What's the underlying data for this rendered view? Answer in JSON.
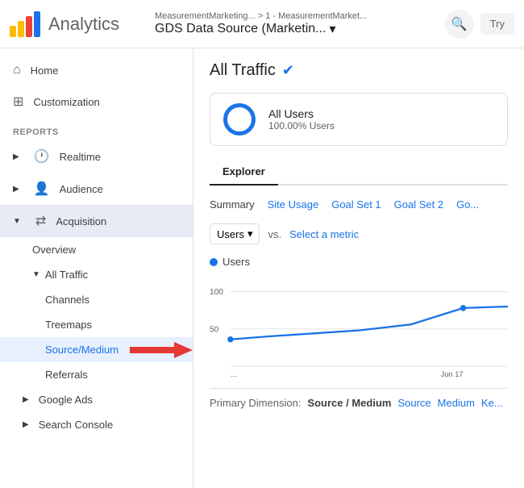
{
  "header": {
    "logo_title": "Analytics",
    "breadcrumb": "MeasurementMarketing... > 1 - MeasurementMarket...",
    "datasource": "GDS Data Source (Marketin...",
    "search_label": "🔍",
    "try_label": "Try"
  },
  "sidebar": {
    "items": [
      {
        "id": "home",
        "label": "Home",
        "icon": "⌂",
        "level": 0
      },
      {
        "id": "customization",
        "label": "Customization",
        "icon": "⊞",
        "level": 0
      }
    ],
    "reports_label": "REPORTS",
    "report_groups": [
      {
        "id": "realtime",
        "label": "Realtime",
        "icon": "🕐",
        "level": 0,
        "expandable": true
      },
      {
        "id": "audience",
        "label": "Audience",
        "icon": "👤",
        "level": 0,
        "expandable": true
      },
      {
        "id": "acquisition",
        "label": "Acquisition",
        "icon": "⇄",
        "level": 0,
        "expanded": true,
        "expandable": true
      }
    ],
    "acquisition_children": [
      {
        "id": "overview",
        "label": "Overview",
        "level": 1
      },
      {
        "id": "all-traffic",
        "label": "All Traffic",
        "level": 1,
        "expanded": true,
        "expand_char": "▼"
      }
    ],
    "all_traffic_children": [
      {
        "id": "channels",
        "label": "Channels",
        "level": 2
      },
      {
        "id": "treemaps",
        "label": "Treemaps",
        "level": 2
      },
      {
        "id": "source-medium",
        "label": "Source/Medium",
        "level": 2,
        "active": true
      },
      {
        "id": "referrals",
        "label": "Referrals",
        "level": 2
      }
    ],
    "further_groups": [
      {
        "id": "google-ads",
        "label": "Google Ads",
        "expandable": true
      },
      {
        "id": "search-console",
        "label": "Search Console",
        "expandable": true
      }
    ]
  },
  "content": {
    "page_title": "All Traffic",
    "segment_name": "All Users",
    "segment_pct": "100.00% Users",
    "tabs": [
      {
        "id": "explorer",
        "label": "Explorer",
        "active": true
      }
    ],
    "sub_tabs": [
      {
        "id": "summary",
        "label": "Summary",
        "active": true
      },
      {
        "id": "site-usage",
        "label": "Site Usage"
      },
      {
        "id": "goal-set-1",
        "label": "Goal Set 1"
      },
      {
        "id": "goal-set-2",
        "label": "Goal Set 2"
      },
      {
        "id": "go",
        "label": "Go..."
      }
    ],
    "metric_select": "Users",
    "vs_label": "vs.",
    "select_metric": "Select a metric",
    "chart_legend": "Users",
    "chart_y_labels": [
      "100",
      "50"
    ],
    "chart_x_labels": [
      "...",
      "Jun 17"
    ],
    "primary_dim_label": "Primary Dimension:",
    "primary_dim_active": "Source / Medium",
    "primary_dim_links": [
      "Source",
      "Medium",
      "Ke..."
    ]
  },
  "colors": {
    "blue": "#1a73e8",
    "light_blue_bg": "#e8f0fe",
    "border": "#dadce0",
    "text_dark": "#202124",
    "text_mid": "#3c4043",
    "text_light": "#5f6368",
    "logo_bar1": "#fbbc04",
    "logo_bar2": "#fbbc04",
    "logo_bar3": "#ea4335",
    "logo_bar4": "#1a73e8"
  }
}
